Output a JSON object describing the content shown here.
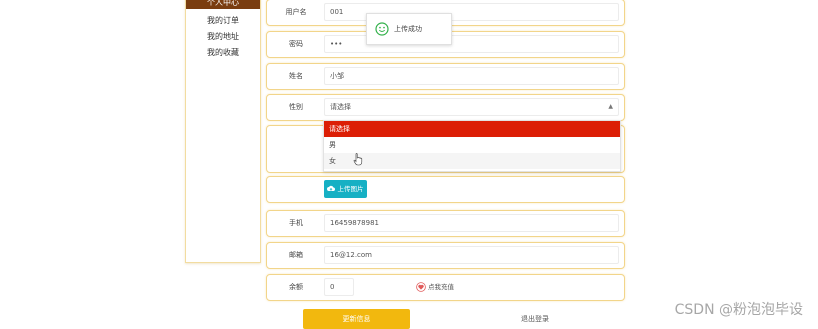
{
  "sidebar": {
    "header": "个人中心",
    "items": [
      {
        "label": "我的订单"
      },
      {
        "label": "我的地址"
      },
      {
        "label": "我的收藏"
      }
    ]
  },
  "form": {
    "username": {
      "label": "用户名",
      "value": "001"
    },
    "password": {
      "label": "密码",
      "value": "•••"
    },
    "name": {
      "label": "姓名",
      "value": "小邹"
    },
    "gender": {
      "label": "性别",
      "placeholder": "请选择",
      "options": [
        "请选择",
        "男",
        "女"
      ],
      "selected": "请选择"
    },
    "upload": {
      "label": "上传图片"
    },
    "phone": {
      "label": "手机",
      "value": "16459878981"
    },
    "email": {
      "label": "邮箱",
      "value": "16@12.com"
    },
    "balance": {
      "label": "余额",
      "value": "0",
      "recharge": "点我充值"
    }
  },
  "toast": {
    "message": "上传成功",
    "icon": "smile-icon",
    "color": "#33b14b"
  },
  "actions": {
    "update": "更新信息",
    "logout": "退出登录"
  },
  "colors": {
    "accent": "#f2b80e",
    "selected": "#dc1e05",
    "upload": "#16b0c4",
    "sidebar_header": "#7a3d10"
  },
  "watermark": "CSDN @粉泡泡毕设"
}
